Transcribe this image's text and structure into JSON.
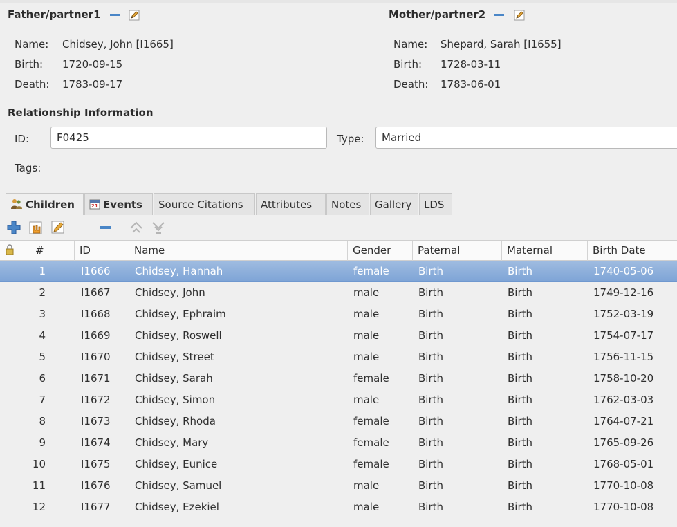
{
  "father": {
    "header": "Father/partner1",
    "name_label": "Name:",
    "name_value": "Chidsey, John [I1665]",
    "birth_label": "Birth:",
    "birth_value": "1720-09-15",
    "death_label": "Death:",
    "death_value": "1783-09-17"
  },
  "mother": {
    "header": "Mother/partner2",
    "name_label": "Name:",
    "name_value": "Shepard, Sarah [I1655]",
    "birth_label": "Birth:",
    "birth_value": "1728-03-11",
    "death_label": "Death:",
    "death_value": "1783-06-01"
  },
  "relationship": {
    "header": "Relationship Information",
    "id_label": "ID:",
    "id_value": "F0425",
    "type_label": "Type:",
    "type_value": "Married",
    "tags_label": "Tags:"
  },
  "tabs": [
    {
      "label": "Children",
      "active": true
    },
    {
      "label": "Events",
      "active": false
    },
    {
      "label": "Source Citations",
      "active": false
    },
    {
      "label": "Attributes",
      "active": false
    },
    {
      "label": "Notes",
      "active": false
    },
    {
      "label": "Gallery",
      "active": false
    },
    {
      "label": "LDS",
      "active": false
    }
  ],
  "columns": {
    "num": "#",
    "id": "ID",
    "name": "Name",
    "gender": "Gender",
    "paternal": "Paternal",
    "maternal": "Maternal",
    "birth_date": "Birth Date"
  },
  "children": [
    {
      "num": "1",
      "id": "I1666",
      "name": "Chidsey, Hannah",
      "gender": "female",
      "paternal": "Birth",
      "maternal": "Birth",
      "birth": "1740-05-06",
      "selected": true
    },
    {
      "num": "2",
      "id": "I1667",
      "name": "Chidsey, John",
      "gender": "male",
      "paternal": "Birth",
      "maternal": "Birth",
      "birth": "1749-12-16"
    },
    {
      "num": "3",
      "id": "I1668",
      "name": "Chidsey, Ephraim",
      "gender": "male",
      "paternal": "Birth",
      "maternal": "Birth",
      "birth": "1752-03-19"
    },
    {
      "num": "4",
      "id": "I1669",
      "name": "Chidsey, Roswell",
      "gender": "male",
      "paternal": "Birth",
      "maternal": "Birth",
      "birth": "1754-07-17"
    },
    {
      "num": "5",
      "id": "I1670",
      "name": "Chidsey, Street",
      "gender": "male",
      "paternal": "Birth",
      "maternal": "Birth",
      "birth": "1756-11-15"
    },
    {
      "num": "6",
      "id": "I1671",
      "name": "Chidsey, Sarah",
      "gender": "female",
      "paternal": "Birth",
      "maternal": "Birth",
      "birth": "1758-10-20"
    },
    {
      "num": "7",
      "id": "I1672",
      "name": "Chidsey, Simon",
      "gender": "male",
      "paternal": "Birth",
      "maternal": "Birth",
      "birth": "1762-03-03"
    },
    {
      "num": "8",
      "id": "I1673",
      "name": "Chidsey, Rhoda",
      "gender": "female",
      "paternal": "Birth",
      "maternal": "Birth",
      "birth": "1764-07-21"
    },
    {
      "num": "9",
      "id": "I1674",
      "name": "Chidsey, Mary",
      "gender": "female",
      "paternal": "Birth",
      "maternal": "Birth",
      "birth": "1765-09-26"
    },
    {
      "num": "10",
      "id": "I1675",
      "name": "Chidsey, Eunice",
      "gender": "female",
      "paternal": "Birth",
      "maternal": "Birth",
      "birth": "1768-05-01"
    },
    {
      "num": "11",
      "id": "I1676",
      "name": "Chidsey, Samuel",
      "gender": "male",
      "paternal": "Birth",
      "maternal": "Birth",
      "birth": "1770-10-08"
    },
    {
      "num": "12",
      "id": "I1677",
      "name": "Chidsey, Ezekiel",
      "gender": "male",
      "paternal": "Birth",
      "maternal": "Birth",
      "birth": "1770-10-08"
    }
  ],
  "colors": {
    "accent": "#4a86c7",
    "selection": "#86aad8"
  }
}
